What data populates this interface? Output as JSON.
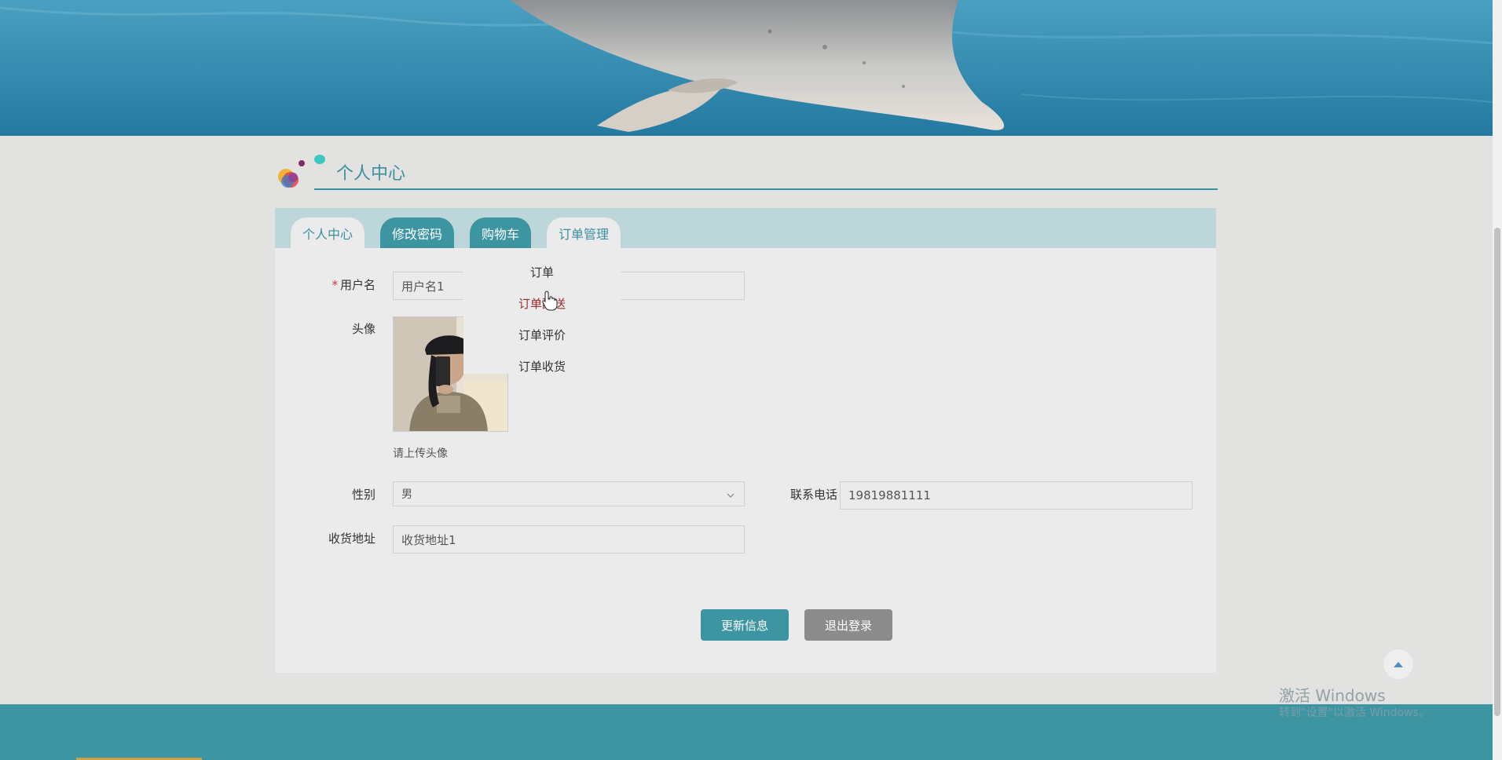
{
  "section": {
    "title": "个人中心"
  },
  "tabs": [
    {
      "label": "个人中心"
    },
    {
      "label": "修改密码"
    },
    {
      "label": "购物车"
    },
    {
      "label": "订单管理"
    }
  ],
  "order_menu": {
    "items": [
      {
        "label": "订单"
      },
      {
        "label": "订单配送"
      },
      {
        "label": "订单评价"
      },
      {
        "label": "订单收货"
      }
    ]
  },
  "form": {
    "username": {
      "label": "用户名",
      "value": "用户名1",
      "required": true
    },
    "avatar": {
      "label": "头像",
      "hint": "请上传头像"
    },
    "gender": {
      "label": "性别",
      "value": "男"
    },
    "phone": {
      "label": "联系电话",
      "value": "19819881111"
    },
    "address": {
      "label": "收货地址",
      "value": "收货地址1"
    }
  },
  "actions": {
    "update_label": "更新信息",
    "logout_label": "退出登录"
  },
  "watermark": {
    "title": "激活 Windows",
    "subtitle": "转到\"设置\"以激活 Windows。"
  },
  "colors": {
    "accent": "#3e95a2",
    "tab_bar": "#bcd6d9",
    "footer": "#3e95a2",
    "hover_text": "#a02b2b"
  },
  "icons": [
    "app-logo-icon",
    "chevron-down-icon",
    "arrow-up-icon",
    "pointer-cursor-icon"
  ]
}
